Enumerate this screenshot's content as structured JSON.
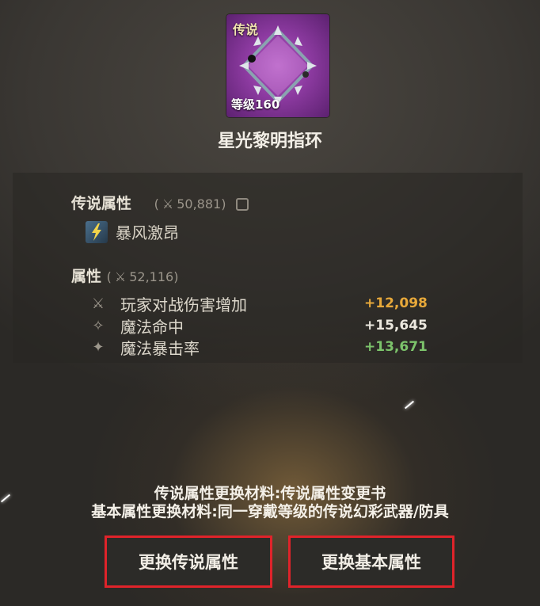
{
  "item": {
    "grade": "传说",
    "level_label": "等级160",
    "name": "星光黎明指环"
  },
  "legendary_attr": {
    "title": "传说属性",
    "power": "50,881",
    "skill_name": "暴风激昂"
  },
  "base_attr": {
    "title": "属性",
    "power": "52,116",
    "rows": [
      {
        "label": "玩家对战伤害增加",
        "value": "+12,098",
        "value_color": "#e8a93a",
        "icon": "crossed-swords-icon"
      },
      {
        "label": "魔法命中",
        "value": "+15,645",
        "value_color": "#ece8df",
        "icon": "magic-hit-icon"
      },
      {
        "label": "魔法暴击率",
        "value": "+13,671",
        "value_color": "#7cc36b",
        "icon": "magic-crit-icon"
      }
    ]
  },
  "materials": {
    "line1": "传说属性更换材料:传说属性变更书",
    "line2": "基本属性更换材料:同一穿戴等级的传说幻彩武器/防具"
  },
  "buttons": {
    "change_legendary": "更换传说属性",
    "change_base": "更换基本属性"
  }
}
